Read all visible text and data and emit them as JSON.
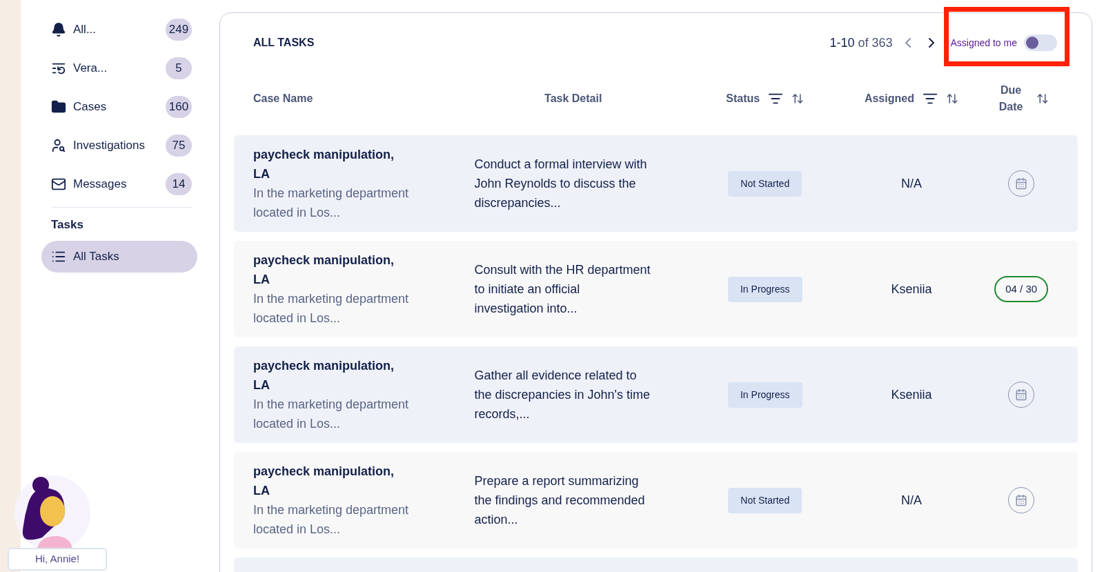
{
  "sidebar": {
    "items": [
      {
        "label": "All...",
        "count": "249",
        "selected": false
      },
      {
        "label": "Vera...",
        "count": "5",
        "selected": false
      },
      {
        "label": "Cases",
        "count": "160",
        "selected": false
      },
      {
        "label": "Investigations",
        "count": "75",
        "selected": false
      },
      {
        "label": "Messages",
        "count": "14",
        "selected": false
      }
    ],
    "section": {
      "title": "Tasks",
      "items": [
        {
          "label": "All Tasks",
          "selected": true
        }
      ]
    },
    "greeting": "Hi, Annie!"
  },
  "tasks": {
    "title": "ALL TASKS",
    "pager": {
      "range": "1-10",
      "total": "of 363",
      "prev_disabled": true,
      "next_disabled": false
    },
    "assigned_to_me": {
      "label": "Assigned to me",
      "on": false
    },
    "columns": [
      {
        "label": "Case Name",
        "kind": "plain"
      },
      {
        "label": "Task Detail",
        "kind": "plain"
      },
      {
        "label": "Status",
        "kind": "filter-sort"
      },
      {
        "label": "Assigned",
        "kind": "filter-sort"
      },
      {
        "label": "Due Date",
        "kind": "sort"
      }
    ],
    "rows": [
      {
        "case": "paycheck manipulation, LA",
        "description": "In the marketing department located in Los...",
        "detail": "Conduct a formal interview with John Reynolds to discuss the discrepancies...",
        "status": "Not Started",
        "assigned": "N/A",
        "due": {
          "kind": "calendar"
        }
      },
      {
        "case": "paycheck manipulation, LA",
        "description": "In the marketing department located in Los...",
        "detail": "Consult with the HR department to initiate an official investigation into...",
        "status": "In Progress",
        "assigned": "Kseniia",
        "due": {
          "kind": "date",
          "text": "04 / 30",
          "color": "#1e8a2e"
        }
      },
      {
        "case": "paycheck manipulation, LA",
        "description": "In the marketing department located in Los...",
        "detail": "Gather all evidence related to the discrepancies in John's time records,...",
        "status": "In Progress",
        "assigned": "Kseniia",
        "due": {
          "kind": "calendar"
        }
      },
      {
        "case": "paycheck manipulation, LA",
        "description": "In the marketing department located in Los...",
        "detail": "Prepare a report summarizing the findings and recommended action...",
        "status": "Not Started",
        "assigned": "N/A",
        "due": {
          "kind": "calendar"
        }
      }
    ]
  }
}
